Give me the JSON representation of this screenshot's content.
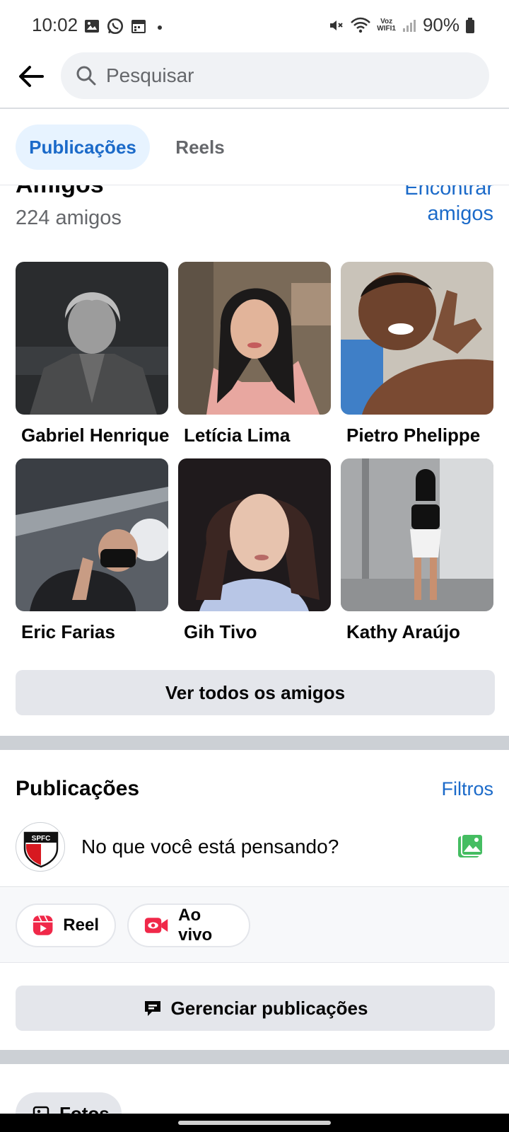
{
  "status_bar": {
    "time": "10:02",
    "voz_top": "Voz",
    "voz_bottom": "WIFI1",
    "battery": "90%"
  },
  "search": {
    "placeholder": "Pesquisar"
  },
  "tabs": [
    {
      "label": "Publicações",
      "active": true
    },
    {
      "label": "Reels",
      "active": false
    }
  ],
  "friends": {
    "title": "Amigos",
    "count": "224 amigos",
    "find_link": "Encontrar amigos",
    "list": [
      {
        "name": "Gabriel Henrique"
      },
      {
        "name": "Letícia Lima"
      },
      {
        "name": "Pietro Phelippe"
      },
      {
        "name": "Eric Farias"
      },
      {
        "name": "Gih Tivo"
      },
      {
        "name": "Kathy Araújo"
      }
    ],
    "see_all": "Ver todos os amigos"
  },
  "posts": {
    "title": "Publicações",
    "filters": "Filtros",
    "composer_prompt": "No que você está pensando?",
    "avatar_text": "SPFC",
    "chips": [
      {
        "label": "Reel",
        "icon": "reel-icon"
      },
      {
        "label": "Ao vivo",
        "icon": "live-video-icon"
      }
    ],
    "manage": "Gerenciar publicações"
  },
  "photos": {
    "label": "Fotos"
  },
  "colors": {
    "accent": "#1b6ac9",
    "tab_active_bg": "#e7f3ff",
    "button_bg": "#e4e6eb",
    "reel_icon": "#f02849",
    "photo_icon": "#45bd62"
  }
}
